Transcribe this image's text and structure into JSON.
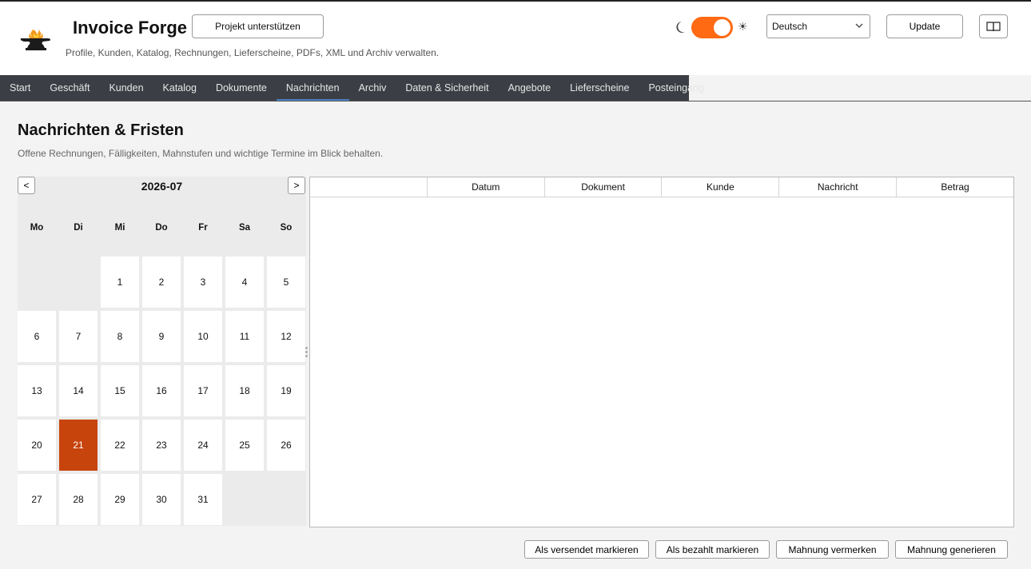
{
  "app": {
    "title": "Invoice Forge",
    "subtitle": "Profile, Kunden, Katalog, Rechnungen, Lieferscheine, PDFs, XML und Archiv verwalten.",
    "support_label": "Projekt unterstützen",
    "update_label": "Update",
    "theme_toggle_on": true,
    "accent_color": "#ff6a13"
  },
  "language": {
    "selected": "Deutsch"
  },
  "tabs": [
    {
      "label": "Start",
      "active": false
    },
    {
      "label": "Geschäft",
      "active": false
    },
    {
      "label": "Kunden",
      "active": false
    },
    {
      "label": "Katalog",
      "active": false
    },
    {
      "label": "Dokumente",
      "active": false
    },
    {
      "label": "Nachrichten",
      "active": true
    },
    {
      "label": "Archiv",
      "active": false
    },
    {
      "label": "Daten & Sicherheit",
      "active": false
    },
    {
      "label": "Angebote",
      "active": false
    },
    {
      "label": "Lieferscheine",
      "active": false
    },
    {
      "label": "Posteingang",
      "active": false
    }
  ],
  "page": {
    "title": "Nachrichten & Fristen",
    "subtitle": "Offene Rechnungen, Fälligkeiten, Mahnstufen und wichtige Termine im Blick behalten."
  },
  "calendar": {
    "month": "2026-07",
    "prev_label": "<",
    "next_label": ">",
    "weekdays": [
      "Mo",
      "Di",
      "Mi",
      "Do",
      "Fr",
      "Sa",
      "So"
    ],
    "first_weekday_index": 2,
    "days_in_month": 31,
    "selected_day": 21,
    "selected_color": "#c7440d"
  },
  "table": {
    "columns": [
      "",
      "Datum",
      "Dokument",
      "Kunde",
      "Nachricht",
      "Betrag"
    ],
    "rows": []
  },
  "actions": {
    "mark_sent": "Als versendet markieren",
    "mark_paid": "Als bezahlt markieren",
    "note_dunning": "Mahnung vermerken",
    "generate_dunning": "Mahnung generieren"
  }
}
